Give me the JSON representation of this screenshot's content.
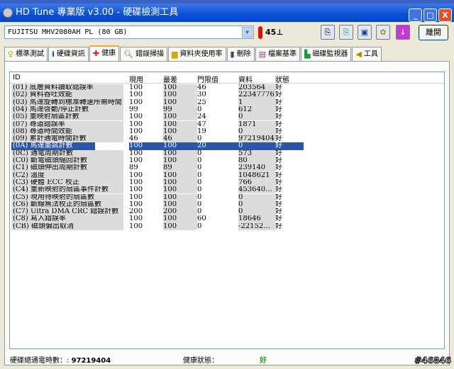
{
  "window": {
    "title": "HD Tune 專業版 v3.00 - 硬碟檢測工具",
    "minimize": "_",
    "maximize": "□",
    "close": "X"
  },
  "toolbar": {
    "drive": "FUJITSU MHV2080AH PL (80 GB)",
    "temperature": "45⊥",
    "exit_label": "離開"
  },
  "tabs": [
    {
      "label": "標準測試",
      "icon": "bulb-icon"
    },
    {
      "label": "硬碟資訊",
      "icon": "info-icon"
    },
    {
      "label": "健康",
      "icon": "red-cross-icon",
      "active": true
    },
    {
      "label": "錯誤掃描",
      "icon": "magnifier-icon"
    },
    {
      "label": "資料夾使用率",
      "icon": "folder-icon"
    },
    {
      "label": "刪除",
      "icon": "trash-icon"
    },
    {
      "label": "檔案基準",
      "icon": "file-benchmark-icon"
    },
    {
      "label": "磁碟監視器",
      "icon": "monitor-chart-icon"
    },
    {
      "label": "工具",
      "icon": "speaker-icon"
    }
  ],
  "table": {
    "headers": [
      "ID",
      "現用",
      "最差",
      "門限值",
      "資料",
      "狀態"
    ],
    "selected_index": 9,
    "rows": [
      [
        "(01) 底層資料讀取錯誤率",
        "100",
        "100",
        "46",
        "203564",
        "好"
      ],
      [
        "(02) 資料吞吐效能",
        "100",
        "100",
        "30",
        "22347776",
        "好"
      ],
      [
        "(03) 馬達旋轉到標准轉速所需時間",
        "100",
        "100",
        "25",
        "1",
        "好"
      ],
      [
        "(04) 馬達啓動/停止計數",
        "99",
        "99",
        "0",
        "612",
        "好"
      ],
      [
        "(05) 重映射扇區計數",
        "100",
        "100",
        "24",
        "0",
        "好"
      ],
      [
        "(07) 尋道錯誤率",
        "100",
        "100",
        "47",
        "1871",
        "好"
      ],
      [
        "(08) 尋道時間效能",
        "100",
        "100",
        "19",
        "0",
        "好"
      ],
      [
        "(09) 累計通電時間計數",
        "46",
        "46",
        "0",
        "97219404",
        "好"
      ],
      [
        "(0A) 馬達重試計數",
        "100",
        "100",
        "20",
        "0",
        "好"
      ],
      [
        "(0C) 通電周期計數",
        "100",
        "100",
        "0",
        "573",
        "好"
      ],
      [
        "(C0) 斷電磁頭縮回計數",
        "100",
        "100",
        "0",
        "80",
        "好"
      ],
      [
        "(C1) 磁頭伸出周期計數",
        "89",
        "89",
        "0",
        "239140",
        "好"
      ],
      [
        "(C2) 溫度",
        "100",
        "100",
        "0",
        "1048621",
        "好"
      ],
      [
        "(C3) 硬體 ECC 校正",
        "100",
        "100",
        "0",
        "766",
        "好"
      ],
      [
        "(C4) 重新映射的扇區事件計數",
        "100",
        "100",
        "0",
        "453640...",
        "好"
      ],
      [
        "(C5) 現用待映射的扇區數",
        "100",
        "100",
        "0",
        "0",
        "好"
      ],
      [
        "(C6) 斷線無法校正的扇區數",
        "100",
        "100",
        "0",
        "0",
        "好"
      ],
      [
        "(C7) Ultra DMA CRC 錯誤計數",
        "200",
        "200",
        "0",
        "0",
        "好"
      ],
      [
        "(C8) 寫入錯誤率",
        "100",
        "100",
        "60",
        "18646",
        "好"
      ],
      [
        "(CB) 磁頭偏出取消",
        "100",
        "100",
        "0",
        "-22152...",
        "好"
      ]
    ]
  },
  "status": {
    "power_on_label": "硬碟總通電時數：:",
    "power_on_value": "97219404",
    "health_label": "健康狀態：",
    "health_value": "好",
    "health_color": "#1aa61a"
  },
  "watermark": "#46846"
}
